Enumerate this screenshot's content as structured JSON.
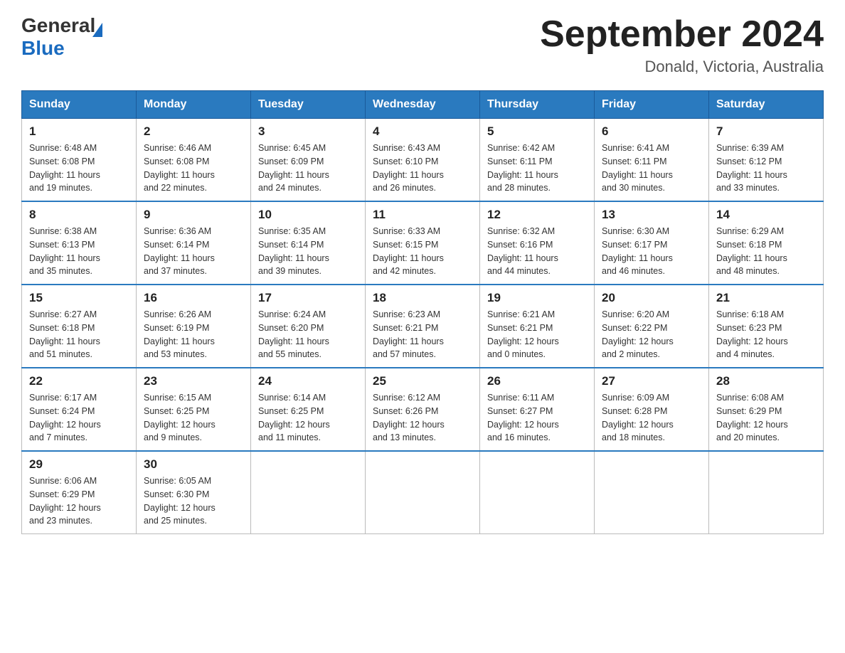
{
  "header": {
    "logo_general": "General",
    "logo_blue": "Blue",
    "title": "September 2024",
    "subtitle": "Donald, Victoria, Australia"
  },
  "weekdays": [
    "Sunday",
    "Monday",
    "Tuesday",
    "Wednesday",
    "Thursday",
    "Friday",
    "Saturday"
  ],
  "weeks": [
    [
      {
        "day": "1",
        "sunrise": "6:48 AM",
        "sunset": "6:08 PM",
        "daylight": "11 hours and 19 minutes."
      },
      {
        "day": "2",
        "sunrise": "6:46 AM",
        "sunset": "6:08 PM",
        "daylight": "11 hours and 22 minutes."
      },
      {
        "day": "3",
        "sunrise": "6:45 AM",
        "sunset": "6:09 PM",
        "daylight": "11 hours and 24 minutes."
      },
      {
        "day": "4",
        "sunrise": "6:43 AM",
        "sunset": "6:10 PM",
        "daylight": "11 hours and 26 minutes."
      },
      {
        "day": "5",
        "sunrise": "6:42 AM",
        "sunset": "6:11 PM",
        "daylight": "11 hours and 28 minutes."
      },
      {
        "day": "6",
        "sunrise": "6:41 AM",
        "sunset": "6:11 PM",
        "daylight": "11 hours and 30 minutes."
      },
      {
        "day": "7",
        "sunrise": "6:39 AM",
        "sunset": "6:12 PM",
        "daylight": "11 hours and 33 minutes."
      }
    ],
    [
      {
        "day": "8",
        "sunrise": "6:38 AM",
        "sunset": "6:13 PM",
        "daylight": "11 hours and 35 minutes."
      },
      {
        "day": "9",
        "sunrise": "6:36 AM",
        "sunset": "6:14 PM",
        "daylight": "11 hours and 37 minutes."
      },
      {
        "day": "10",
        "sunrise": "6:35 AM",
        "sunset": "6:14 PM",
        "daylight": "11 hours and 39 minutes."
      },
      {
        "day": "11",
        "sunrise": "6:33 AM",
        "sunset": "6:15 PM",
        "daylight": "11 hours and 42 minutes."
      },
      {
        "day": "12",
        "sunrise": "6:32 AM",
        "sunset": "6:16 PM",
        "daylight": "11 hours and 44 minutes."
      },
      {
        "day": "13",
        "sunrise": "6:30 AM",
        "sunset": "6:17 PM",
        "daylight": "11 hours and 46 minutes."
      },
      {
        "day": "14",
        "sunrise": "6:29 AM",
        "sunset": "6:18 PM",
        "daylight": "11 hours and 48 minutes."
      }
    ],
    [
      {
        "day": "15",
        "sunrise": "6:27 AM",
        "sunset": "6:18 PM",
        "daylight": "11 hours and 51 minutes."
      },
      {
        "day": "16",
        "sunrise": "6:26 AM",
        "sunset": "6:19 PM",
        "daylight": "11 hours and 53 minutes."
      },
      {
        "day": "17",
        "sunrise": "6:24 AM",
        "sunset": "6:20 PM",
        "daylight": "11 hours and 55 minutes."
      },
      {
        "day": "18",
        "sunrise": "6:23 AM",
        "sunset": "6:21 PM",
        "daylight": "11 hours and 57 minutes."
      },
      {
        "day": "19",
        "sunrise": "6:21 AM",
        "sunset": "6:21 PM",
        "daylight": "12 hours and 0 minutes."
      },
      {
        "day": "20",
        "sunrise": "6:20 AM",
        "sunset": "6:22 PM",
        "daylight": "12 hours and 2 minutes."
      },
      {
        "day": "21",
        "sunrise": "6:18 AM",
        "sunset": "6:23 PM",
        "daylight": "12 hours and 4 minutes."
      }
    ],
    [
      {
        "day": "22",
        "sunrise": "6:17 AM",
        "sunset": "6:24 PM",
        "daylight": "12 hours and 7 minutes."
      },
      {
        "day": "23",
        "sunrise": "6:15 AM",
        "sunset": "6:25 PM",
        "daylight": "12 hours and 9 minutes."
      },
      {
        "day": "24",
        "sunrise": "6:14 AM",
        "sunset": "6:25 PM",
        "daylight": "12 hours and 11 minutes."
      },
      {
        "day": "25",
        "sunrise": "6:12 AM",
        "sunset": "6:26 PM",
        "daylight": "12 hours and 13 minutes."
      },
      {
        "day": "26",
        "sunrise": "6:11 AM",
        "sunset": "6:27 PM",
        "daylight": "12 hours and 16 minutes."
      },
      {
        "day": "27",
        "sunrise": "6:09 AM",
        "sunset": "6:28 PM",
        "daylight": "12 hours and 18 minutes."
      },
      {
        "day": "28",
        "sunrise": "6:08 AM",
        "sunset": "6:29 PM",
        "daylight": "12 hours and 20 minutes."
      }
    ],
    [
      {
        "day": "29",
        "sunrise": "6:06 AM",
        "sunset": "6:29 PM",
        "daylight": "12 hours and 23 minutes."
      },
      {
        "day": "30",
        "sunrise": "6:05 AM",
        "sunset": "6:30 PM",
        "daylight": "12 hours and 25 minutes."
      },
      null,
      null,
      null,
      null,
      null
    ]
  ],
  "labels": {
    "sunrise": "Sunrise:",
    "sunset": "Sunset:",
    "daylight": "Daylight:"
  }
}
